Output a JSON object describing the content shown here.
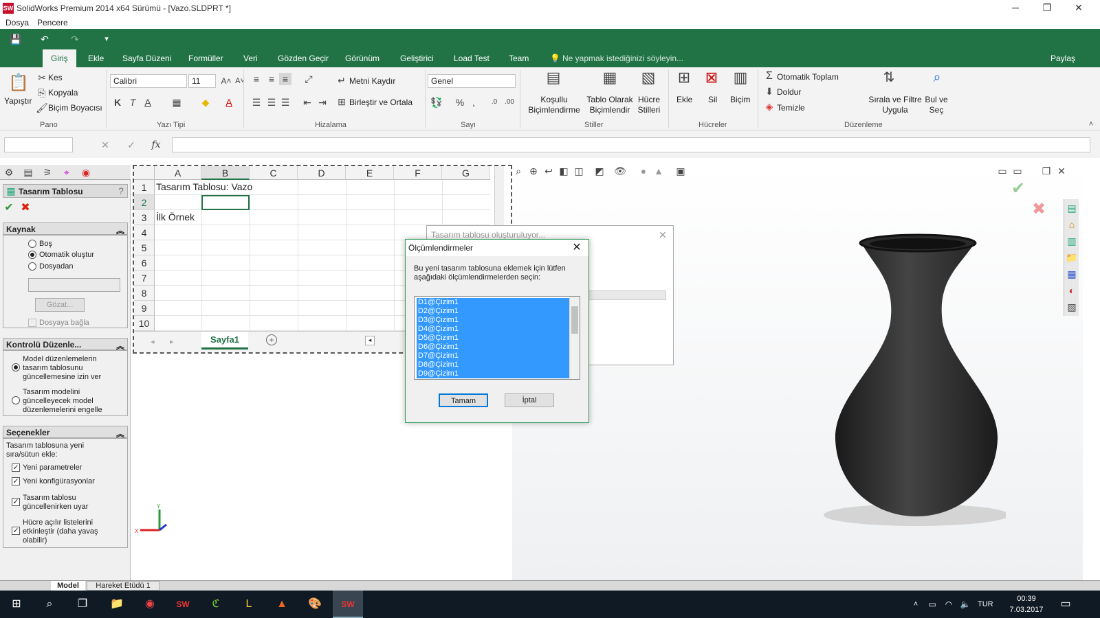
{
  "window": {
    "title": "SolidWorks Premium 2014 x64 Sürümü - [Vazo.SLDPRT *]",
    "logo": "SW"
  },
  "menu": [
    "Dosya",
    "Pencere"
  ],
  "ribbon": {
    "tabs": [
      "Giriş",
      "Ekle",
      "Sayfa Düzeni",
      "Formüller",
      "Veri",
      "Gözden Geçir",
      "Görünüm",
      "Geliştirici",
      "Load Test",
      "Team"
    ],
    "active_tab": "Giriş",
    "tell_me": "Ne yapmak istediğinizi söyleyin...",
    "share": "Paylaş",
    "pano": {
      "paste": "Yapıştır",
      "cut": "Kes",
      "copy": "Kopyala",
      "format_painter": "Biçim Boyacısı",
      "label": "Pano"
    },
    "font": {
      "name": "Calibri",
      "size": "11",
      "bold": "K",
      "italic": "T",
      "underline": "A",
      "label": "Yazı Tipi"
    },
    "alignment": {
      "wrap": "Metni Kaydır",
      "merge": "Birleştir ve Ortala",
      "label": "Hizalama"
    },
    "number": {
      "format": "Genel",
      "label": "Sayı"
    },
    "styles": {
      "conditional": "Koşullu Biçimlendirme",
      "as_table": "Tablo Olarak Biçimlendir",
      "cell_styles": "Hücre Stilleri",
      "label": "Stiller"
    },
    "cells": {
      "insert": "Ekle",
      "delete": "Sil",
      "format": "Biçim",
      "label": "Hücreler"
    },
    "editing": {
      "autosum": "Otomatik Toplam",
      "fill": "Doldur",
      "clear": "Temizle",
      "sort": "Sırala ve Filtre Uygula",
      "find": "Bul ve Seç",
      "label": "Düzenleme"
    }
  },
  "formula_bar": {
    "fx": "fx"
  },
  "left_panel": {
    "title": "Tasarım Tablosu",
    "source": {
      "header": "Kaynak",
      "options": [
        "Boş",
        "Otomatik oluştur",
        "Dosyadan"
      ],
      "selected": 1,
      "browse": "Gözat...",
      "link": "Dosyaya bağla"
    },
    "edit_control": {
      "header": "Kontrolü Düzenle...",
      "option1": "Model düzenlemelerin tasarım tablosunu güncellemesine izin ver",
      "option2": "Tasarım modelini güncelleyecek model düzenlemelerini engelle"
    },
    "options": {
      "header": "Seçenekler",
      "intro": "Tasarım tablosuna yeni sıra/sütun ekle:",
      "items": [
        "Yeni parametreler",
        "Yeni konfigürasyonlar",
        "Tasarım tablosu güncellenirken uyar",
        "Hücre açılır listelerini etkinleştir (daha yavaş olabilir)"
      ]
    }
  },
  "sheet": {
    "columns": [
      "A",
      "B",
      "C",
      "D",
      "E",
      "F",
      "G"
    ],
    "rows": [
      "1",
      "2",
      "3",
      "4",
      "5",
      "6",
      "7",
      "8",
      "9",
      "10"
    ],
    "a1": "Tasarım Tablosu: Vazo",
    "a3": "İlk Örnek",
    "tab": "Sayfa1"
  },
  "progress_dialog": {
    "title": "Tasarım tablosu oluşturuluyor..."
  },
  "dialog": {
    "title": "Ölçümlendirmeler",
    "message": "Bu yeni tasarım tablosuna eklemek için lütfen aşağıdaki ölçümlendirmelerden seçin:",
    "items": [
      "D1@Çizim1",
      "D2@Çizim1",
      "D3@Çizim1",
      "D4@Çizim1",
      "D5@Çizim1",
      "D6@Çizim1",
      "D7@Çizim1",
      "D8@Çizim1",
      "D9@Çizim1"
    ],
    "ok": "Tamam",
    "cancel": "İptal"
  },
  "bottom_tabs": [
    "Model",
    "Hareket Etüdü 1"
  ],
  "taskbar": {
    "lang": "TUR",
    "time": "00:39",
    "date": "7.03.2017"
  },
  "colors": {
    "excel_green": "#217346",
    "selection": "#3399ff",
    "vase": "#2b2b2b"
  }
}
